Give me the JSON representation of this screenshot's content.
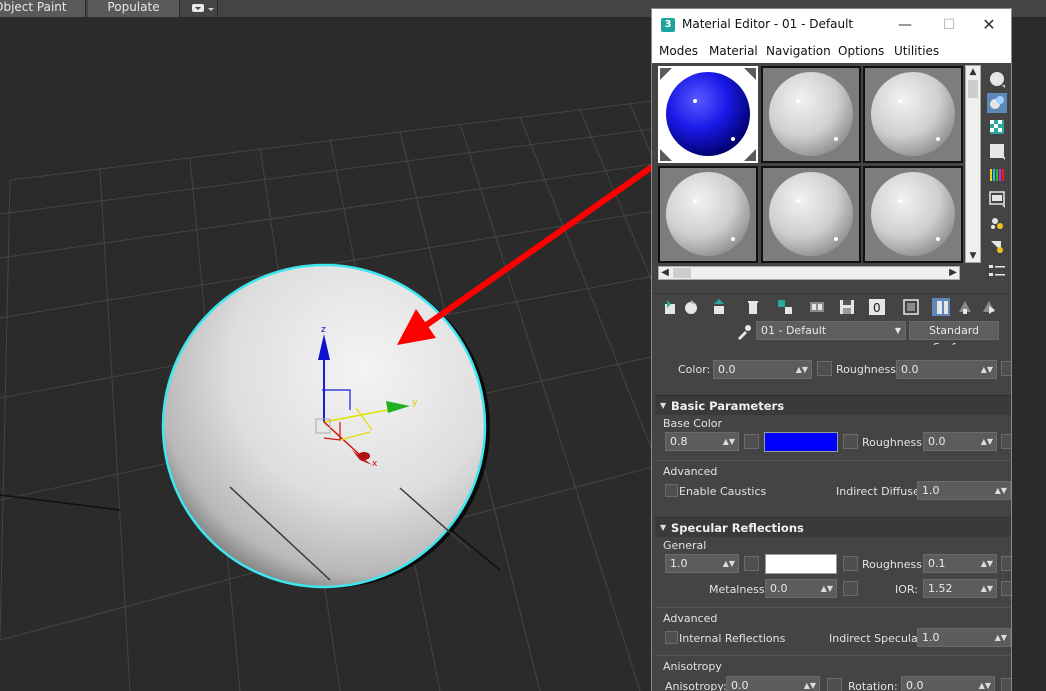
{
  "toolbar": {
    "object_paint": "Object Paint",
    "populate": "Populate"
  },
  "viewport": {
    "gizmo_axes": {
      "z": "z",
      "y": "y",
      "x": "x"
    },
    "annotation_arrow_color": "#ff0000",
    "selection_color": "#3ee6f0"
  },
  "material_editor": {
    "logo": "3",
    "title": "Material Editor - 01 - Default",
    "menu": [
      "Modes",
      "Material",
      "Navigation",
      "Options",
      "Utilities"
    ],
    "name_field": "01 - Default",
    "type_button": "Standard Surface",
    "active_color": "#0000ff",
    "top_row": {
      "color_label": "Color:",
      "color_value": "0.0",
      "roughness_label": "Roughness:",
      "roughness_value": "0.0"
    },
    "basic": {
      "header": "Basic Parameters",
      "base_color_label": "Base Color",
      "weight_value": "0.8",
      "roughness_label": "Roughness:",
      "roughness_value": "0.0",
      "advanced_label": "Advanced",
      "enable_caustics": "Enable Caustics",
      "indirect_diffuse_label": "Indirect Diffuse:",
      "indirect_diffuse_value": "1.0",
      "swatch_color": "#0000ff"
    },
    "specular": {
      "header": "Specular Reflections",
      "general_label": "General",
      "weight_value": "1.0",
      "roughness_label": "Roughness:",
      "roughness_value": "0.1",
      "metalness_label": "Metalness:",
      "metalness_value": "0.0",
      "ior_label": "IOR:",
      "ior_value": "1.52",
      "advanced_label": "Advanced",
      "internal_reflections": "Internal Reflections",
      "indirect_specular_label": "Indirect Specular:",
      "indirect_specular_value": "1.0",
      "anisotropy_group": "Anisotropy",
      "anisotropy_label": "Anisotropy:",
      "anisotropy_value": "0.0",
      "rotation_label": "Rotation:",
      "rotation_value": "0.0",
      "swatch_color": "#ffffff"
    }
  }
}
